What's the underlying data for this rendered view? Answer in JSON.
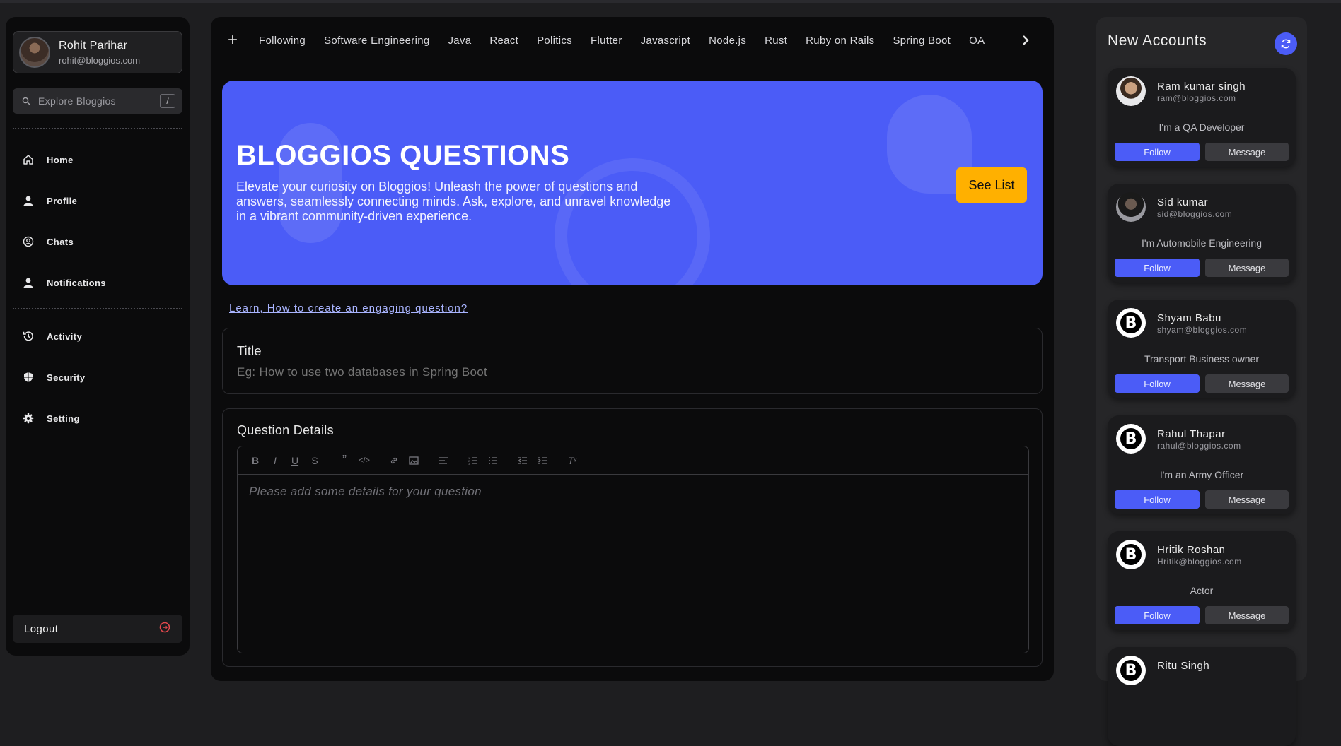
{
  "user": {
    "name": "Rohit Parihar",
    "email": "rohit@bloggios.com"
  },
  "search": {
    "placeholder": "Explore Bloggios",
    "shortcut": "/"
  },
  "nav_primary": [
    {
      "label": "Home",
      "icon": "home-icon"
    },
    {
      "label": "Profile",
      "icon": "user-icon"
    },
    {
      "label": "Chats",
      "icon": "chat-icon"
    },
    {
      "label": "Notifications",
      "icon": "user-icon"
    }
  ],
  "nav_secondary": [
    {
      "label": "Activity",
      "icon": "history-icon"
    },
    {
      "label": "Security",
      "icon": "shield-icon"
    },
    {
      "label": "Setting",
      "icon": "gear-icon"
    }
  ],
  "logout": {
    "label": "Logout"
  },
  "tabs": [
    "Following",
    "Software Engineering",
    "Java",
    "React",
    "Politics",
    "Flutter",
    "Javascript",
    "Node.js",
    "Rust",
    "Ruby on Rails",
    "Spring Boot",
    "OA"
  ],
  "hero": {
    "title": "BLOGGIOS QUESTIONS",
    "description": "Elevate your curiosity on Bloggios! Unleash the power of questions and answers, seamlessly connecting minds. Ask, explore, and unravel knowledge in a vibrant community-driven experience.",
    "button": "See List"
  },
  "learn_link": "Learn, How to create an engaging question?",
  "title_field": {
    "label": "Title",
    "placeholder": "Eg: How to use two databases in Spring Boot"
  },
  "details_field": {
    "label": "Question Details",
    "placeholder": "Please add some details for your question"
  },
  "right_panel": {
    "title": "New Accounts",
    "accounts": [
      {
        "name": "Ram kumar singh",
        "email": "ram@bloggios.com",
        "bio": "I'm a QA Developer",
        "avatar": "photo",
        "follow": "Follow",
        "message": "Message"
      },
      {
        "name": "Sid kumar",
        "email": "sid@bloggios.com",
        "bio": "I'm Automobile Engineering",
        "avatar": "photo",
        "follow": "Follow",
        "message": "Message"
      },
      {
        "name": "Shyam Babu",
        "email": "shyam@bloggios.com",
        "bio": "Transport Business owner",
        "avatar": "bloggios-logo",
        "follow": "Follow",
        "message": "Message"
      },
      {
        "name": "Rahul Thapar",
        "email": "rahul@bloggios.com",
        "bio": "I'm an Army Officer",
        "avatar": "bloggios-logo",
        "follow": "Follow",
        "message": "Message"
      },
      {
        "name": "Hritik Roshan",
        "email": "Hritik@bloggios.com",
        "bio": "Actor",
        "avatar": "bloggios-logo",
        "follow": "Follow",
        "message": "Message"
      },
      {
        "name": "Ritu Singh",
        "email": "",
        "bio": "",
        "avatar": "bloggios-logo",
        "follow": "",
        "message": ""
      }
    ]
  },
  "colors": {
    "accent": "#4b5cf7",
    "cta": "#ffb000",
    "logout_icon": "#e5484d"
  }
}
